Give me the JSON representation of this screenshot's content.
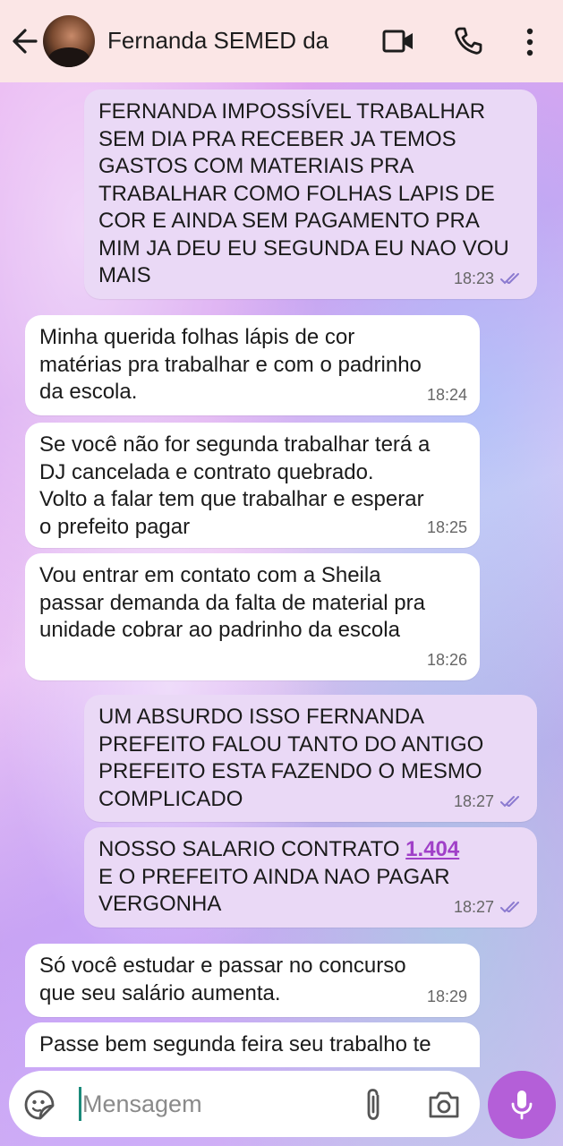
{
  "header": {
    "back_icon": "arrow-left-icon",
    "contact_name": "Fernanda SEMED da",
    "icons": [
      "video-call-icon",
      "phone-icon",
      "more-vert-icon"
    ]
  },
  "messages": [
    {
      "dir": "out",
      "text": "FERNANDA IMPOSSÍVEL TRABALHAR\nSEM DIA PRA RECEBER JA TEMOS\nGASTOS COM MATERIAIS PRA\nTRABALHAR COMO FOLHAS LAPIS DE\nCOR E AINDA SEM PAGAMENTO PRA\nMIM JA DEU EU SEGUNDA EU NAO VOU\nMAIS",
      "time": "18:23",
      "status": "read"
    },
    {
      "dir": "in",
      "text": "Minha querida folhas lápis de cor\nmatérias pra trabalhar e com o padrinho\nda escola.",
      "time": "18:24"
    },
    {
      "dir": "in",
      "text": "Se você não for segunda trabalhar terá a\nDJ cancelada e contrato quebrado.\nVolto a falar tem que trabalhar e esperar\no prefeito pagar",
      "time": "18:25"
    },
    {
      "dir": "in",
      "text": "Vou entrar em contato com a Sheila\npassar demanda da falta de material pra\nunidade cobrar ao padrinho da escola",
      "time": "18:26"
    },
    {
      "dir": "out",
      "text": "UM ABSURDO ISSO FERNANDA\nPREFEITO FALOU TANTO DO ANTIGO\nPREFEITO ESTA FAZENDO O MESMO\nCOMPLICADO",
      "time": "18:27",
      "status": "read"
    },
    {
      "dir": "out",
      "text_before_link": "NOSSO SALARIO CONTRATO ",
      "link": "1.404",
      "text_after_link": "\nE O PREFEITO AINDA NAO PAGAR\nVERGONHA",
      "time": "18:27",
      "status": "read"
    },
    {
      "dir": "in",
      "text": "Só você estudar e passar no concurso\nque seu salário aumenta.",
      "time": "18:29"
    },
    {
      "dir": "in",
      "text": "Passe bem segunda feira seu trabalho te",
      "time": ""
    }
  ],
  "composer": {
    "placeholder": "Mensagem",
    "emoji_icon": "sticker-icon",
    "attach_icon": "paperclip-icon",
    "camera_icon": "camera-icon",
    "mic_icon": "microphone-icon"
  },
  "colors": {
    "header_bg": "#fbe6e6",
    "outgoing_bubble": "#ead9f6",
    "incoming_bubble": "#ffffff",
    "accent": "#b45fd8",
    "read_tick": "#8c7bd0"
  }
}
